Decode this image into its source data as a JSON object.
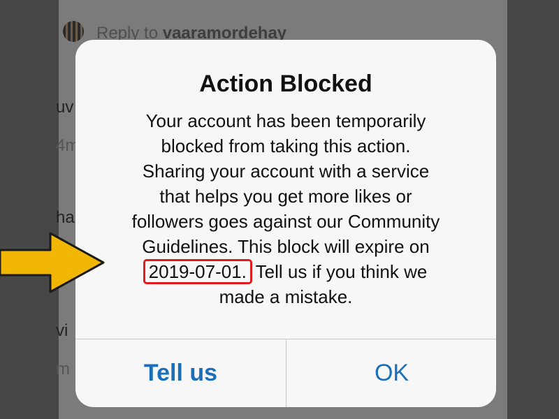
{
  "background": {
    "reply_prefix": "Reply to",
    "reply_user": "vaaramordehay",
    "fragments": [
      "uv",
      "4m",
      "ha",
      "vi",
      "m"
    ]
  },
  "dialog": {
    "title": "Action Blocked",
    "message_lines": [
      "Your account has been temporarily",
      "blocked from taking this action.",
      "Sharing your account with a service",
      "that helps you get more likes or",
      "followers goes against our Community",
      "Guidelines. This block will expire on"
    ],
    "expiry_date": "2019-07-01.",
    "message_after_date": " Tell us if you think we",
    "message_last_line": "made a mistake.",
    "buttons": {
      "left_label": "Tell us",
      "right_label": "OK"
    }
  },
  "colors": {
    "button_text": "#1a6fb8",
    "highlight_box": "#e01b1b",
    "arrow": "#f2b705"
  }
}
